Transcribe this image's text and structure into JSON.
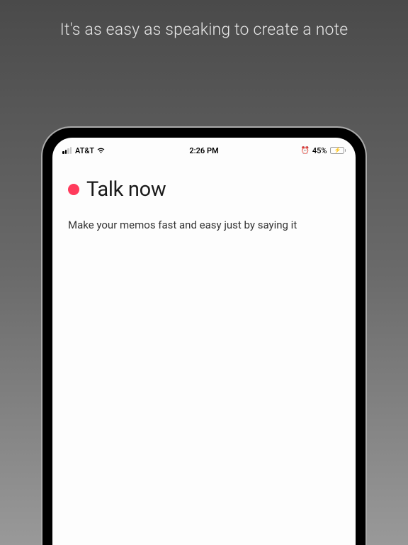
{
  "promo": {
    "headline": "It's as easy as speaking to create a note"
  },
  "statusBar": {
    "carrier": "AT&T",
    "time": "2:26 PM",
    "batteryPercent": "45%"
  },
  "app": {
    "title": "Talk now",
    "body": "Make your memos fast and easy just by saying it"
  }
}
